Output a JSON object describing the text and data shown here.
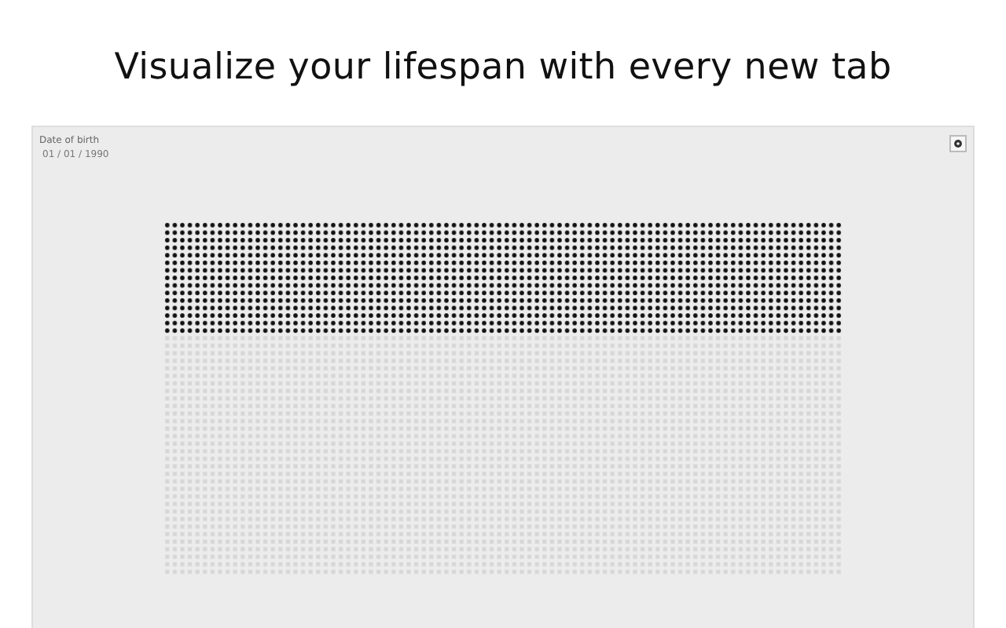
{
  "headline": "Visualize your lifespan with every new tab",
  "birth_date": {
    "label": "Date of birth",
    "value": "01 / 01 / 1990"
  }
}
